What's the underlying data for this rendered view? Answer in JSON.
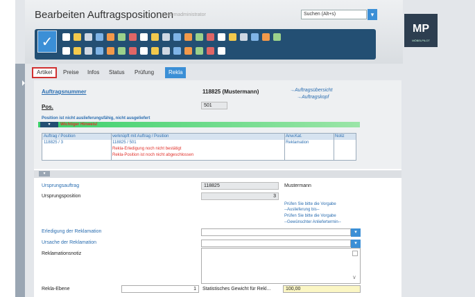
{
  "window": {
    "title": "Bearbeiten Auftragspositionen",
    "subtitle": "Systemadministrator",
    "search_placeholder": "Suchen (Alt+s)"
  },
  "logo": {
    "text": "MP",
    "sub": "MÖBELPILOT"
  },
  "toolbar_icons_row1": [
    "new-doc",
    "folder",
    "trash",
    "help",
    "back",
    "search",
    "print",
    "first",
    "prev",
    "next",
    "last",
    "group",
    "merge",
    "link",
    "table",
    "list",
    "export",
    "import",
    "chart",
    "plus"
  ],
  "toolbar_icons_row2": [
    "doc-a",
    "copy",
    "doc-b",
    "truck",
    "doc-c",
    "doc-d",
    "doc-e",
    "doc-f",
    "doc-g",
    "doc-h",
    "settings",
    "hat",
    "filter",
    "doc-i",
    "grid"
  ],
  "tabs": [
    "Artikel",
    "Preise",
    "Infos",
    "Status",
    "Prüfung",
    "Rekla"
  ],
  "header_section": {
    "auftragsnummer_label": "Auftragsnummer",
    "auftragsnummer_value": "118825 (Mustermann)",
    "link_uebersicht": "→Auftragsübersicht",
    "link_kopf": "→Auftragskopf",
    "pos_label": "Pos.",
    "pos_value": "501"
  },
  "alert": {
    "status_text": "Position ist nicht auslieferungsfähig, nicht ausgeliefert",
    "hint": "Wichtiger Hinweis!"
  },
  "hint_table": {
    "headers": [
      "Auftrag / Position",
      "verknüpft mit Auftrag / Position",
      "Anw.Kat.",
      "Notiz"
    ],
    "row": {
      "auftrag": "118825 / 3",
      "verknuepft": "118825 / 501",
      "note1": "Rekla-Erledigung noch nicht bestätigt",
      "note2": "Rekla-Position ist noch nicht abgeschlossen",
      "kat": "Reklamation"
    }
  },
  "form": {
    "ursprungsauftrag_label": "Ursprungsauftrag",
    "ursprungsauftrag_value": "118825",
    "ursprungsauftrag_name": "Mustermann",
    "ursprungsposition_label": "Ursprungsposition",
    "ursprungsposition_value": "3",
    "hint1": "Prüfen Sie bitte die Vorgabe",
    "hint2": "--Auslieferung bis--",
    "hint3": "Prüfen Sie bitte die Vorgabe",
    "hint4": "--Gewünschter Anliefertermin--",
    "erledigung_label": "Erledigung der Reklamation",
    "ursache_label": "Ursache der Reklamation",
    "notiz_label": "Reklamationsnotiz",
    "ebene_label": "Rekla-Ebene",
    "ebene_value": "1",
    "gewicht_label": "Statistisches Gewicht für Rekl...",
    "gewicht_value": "100,00"
  },
  "colors": {
    "accent": "#3b8fd6",
    "toolbar": "#234f73",
    "alert_red": "#e0302a",
    "highlight": "#d03030"
  }
}
